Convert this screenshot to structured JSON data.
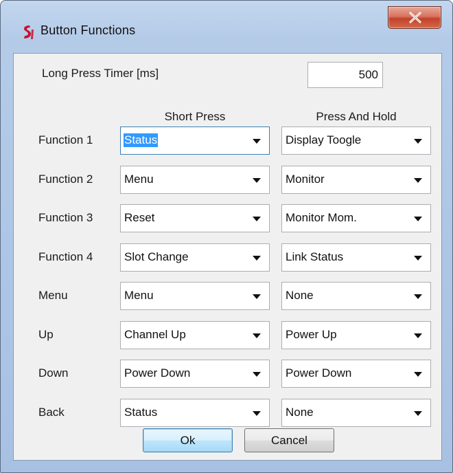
{
  "window": {
    "title": "Button Functions",
    "close_label": "X"
  },
  "timer": {
    "label": "Long Press Timer [ms]",
    "value": "500"
  },
  "columns": {
    "short": "Short Press",
    "hold": "Press And Hold"
  },
  "rows": [
    {
      "label": "Function 1",
      "short": "Status",
      "hold": "Display Toogle"
    },
    {
      "label": "Function 2",
      "short": "Menu",
      "hold": "Monitor"
    },
    {
      "label": "Function 3",
      "short": "Reset",
      "hold": "Monitor Mom."
    },
    {
      "label": "Function 4",
      "short": "Slot Change",
      "hold": "Link Status"
    },
    {
      "label": "Menu",
      "short": "Menu",
      "hold": "None"
    },
    {
      "label": "Up",
      "short": "Channel Up",
      "hold": "Power Up"
    },
    {
      "label": "Down",
      "short": "Power Down",
      "hold": "Power Down"
    },
    {
      "label": "Back",
      "short": "Status",
      "hold": "None"
    }
  ],
  "buttons": {
    "ok": "Ok",
    "cancel": "Cancel"
  },
  "colors": {
    "selection": "#3399ff",
    "close_button": "#c2422a",
    "app_icon": "#c8102e"
  },
  "icons": {
    "app": "app-logo-icon",
    "close": "close-icon",
    "dropdown": "chevron-down-icon"
  }
}
